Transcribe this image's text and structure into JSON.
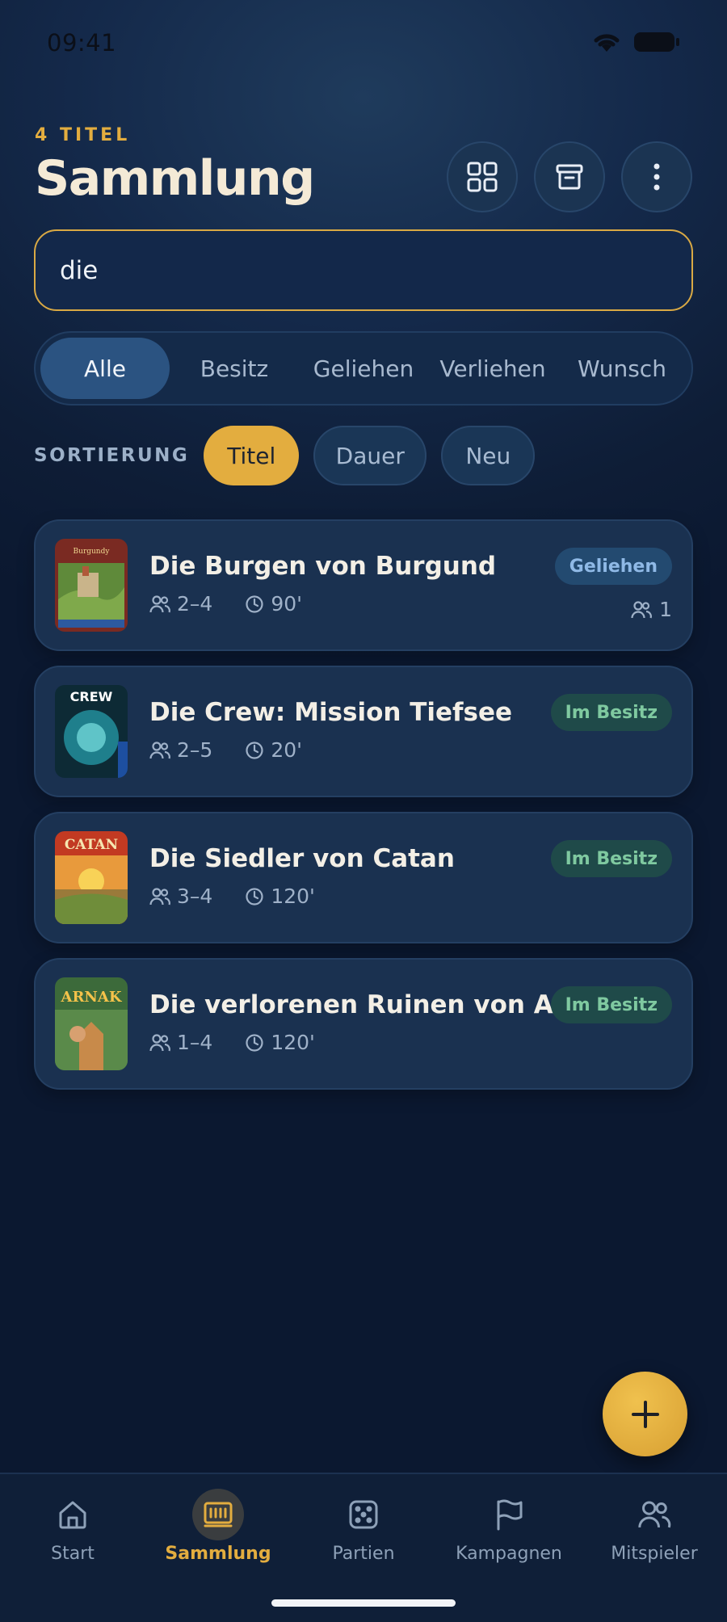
{
  "status_bar": {
    "time": "09:41"
  },
  "header": {
    "count_label": "4 TITEL",
    "title": "Sammlung",
    "actions": [
      {
        "icon": "grid-icon"
      },
      {
        "icon": "archive-icon"
      },
      {
        "icon": "more-vertical-icon"
      }
    ]
  },
  "search": {
    "value": "die"
  },
  "filter_tabs": [
    {
      "label": "Alle",
      "active": true
    },
    {
      "label": "Besitz",
      "active": false
    },
    {
      "label": "Geliehen",
      "active": false
    },
    {
      "label": "Verliehen",
      "active": false
    },
    {
      "label": "Wunsch",
      "active": false
    }
  ],
  "sort": {
    "label": "SORTIERUNG",
    "options": [
      {
        "label": "Titel",
        "active": true
      },
      {
        "label": "Dauer",
        "active": false
      },
      {
        "label": "Neu",
        "active": false
      }
    ]
  },
  "games": [
    {
      "title": "Die Burgen von Burgund",
      "players": "2–4",
      "duration": "90'",
      "status": "Geliehen",
      "status_type": "lent",
      "borrow_count": "1"
    },
    {
      "title": "Die Crew: Mission Tiefsee",
      "players": "2–5",
      "duration": "20'",
      "status": "Im Besitz",
      "status_type": "own"
    },
    {
      "title": "Die Siedler von Catan",
      "players": "3–4",
      "duration": "120'",
      "status": "Im Besitz",
      "status_type": "own"
    },
    {
      "title": "Die verlorenen Ruinen von Arn…",
      "players": "1–4",
      "duration": "120'",
      "status": "Im Besitz",
      "status_type": "own"
    }
  ],
  "colors": {
    "accent": "#e3ad3f",
    "background": "#0e1d36",
    "card": "#1a3150",
    "own_badge": "#7fc9a0",
    "lent_badge": "#8fb9e6"
  },
  "bottom_nav": [
    {
      "label": "Start",
      "icon": "home-icon",
      "active": false
    },
    {
      "label": "Sammlung",
      "icon": "collection-icon",
      "active": true
    },
    {
      "label": "Partien",
      "icon": "dice-icon",
      "active": false
    },
    {
      "label": "Kampagnen",
      "icon": "flag-icon",
      "active": false
    },
    {
      "label": "Mitspieler",
      "icon": "users-icon",
      "active": false
    }
  ]
}
